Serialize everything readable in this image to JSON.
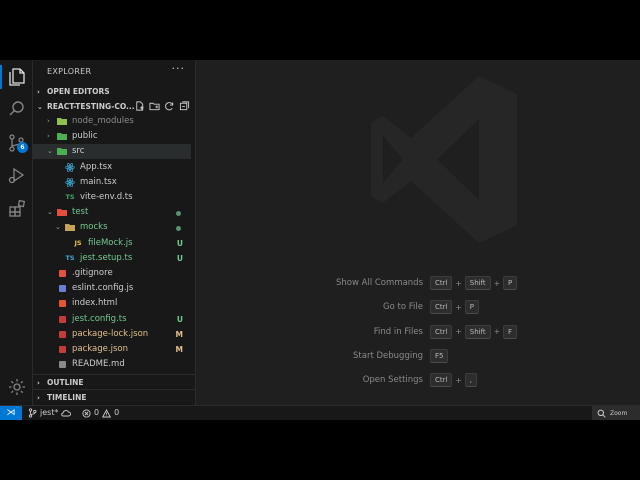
{
  "explorer": {
    "title": "EXPLORER",
    "more": "···"
  },
  "sections": {
    "open_editors": "OPEN EDITORS",
    "project": "REACT-TESTING-CO...",
    "outline": "OUTLINE",
    "timeline": "TIMELINE"
  },
  "activity": {
    "scm_badge": "6"
  },
  "tree": [
    {
      "label": "node_modules",
      "type": "folder",
      "open": false,
      "depth": 0,
      "muted": true,
      "icon_color": "#8bc34a"
    },
    {
      "label": "public",
      "type": "folder",
      "open": false,
      "depth": 0,
      "icon_color": "#4caf50"
    },
    {
      "label": "src",
      "type": "folder",
      "open": true,
      "depth": 0,
      "selected": true,
      "icon_color": "#4caf50"
    },
    {
      "label": "App.tsx",
      "type": "react",
      "depth": 1,
      "icon_color": "#3fa9d6"
    },
    {
      "label": "main.tsx",
      "type": "react",
      "depth": 1,
      "icon_color": "#3fa9d6"
    },
    {
      "label": "vite-env.d.ts",
      "type": "ts",
      "depth": 1,
      "icon_text": "TS",
      "icon_color": "#3ca86b"
    },
    {
      "label": "test",
      "type": "folder",
      "open": true,
      "depth": 0,
      "color": "#73c991",
      "dot": true,
      "icon_color": "#e74c3c"
    },
    {
      "label": "mocks",
      "type": "folder",
      "open": true,
      "depth": 1,
      "color": "#73c991",
      "dot": true,
      "icon_color": "#c8a15a"
    },
    {
      "label": "fileMock.js",
      "type": "js",
      "depth": 2,
      "icon_text": "JS",
      "icon_color": "#e0c44c",
      "color": "#73c991",
      "status": "U"
    },
    {
      "label": "jest.setup.ts",
      "type": "ts",
      "depth": 1,
      "icon_text": "TS",
      "icon_color": "#3fa9d6",
      "color": "#73c991",
      "status": "U"
    },
    {
      "label": ".gitignore",
      "type": "git",
      "depth": 0,
      "icon_color": "#e5533d"
    },
    {
      "label": "eslint.config.js",
      "type": "eslint",
      "depth": 0,
      "icon_color": "#6b7fd7"
    },
    {
      "label": "index.html",
      "type": "html",
      "depth": 0,
      "icon_color": "#e4572e"
    },
    {
      "label": "jest.config.ts",
      "type": "jest",
      "depth": 0,
      "icon_color": "#c43b3b",
      "color": "#73c991",
      "status": "U"
    },
    {
      "label": "package-lock.json",
      "type": "npm",
      "depth": 0,
      "icon_color": "#c43b3b",
      "color": "#e2c08d",
      "status": "M"
    },
    {
      "label": "package.json",
      "type": "npm",
      "depth": 0,
      "icon_color": "#c43b3b",
      "color": "#e2c08d",
      "status": "M"
    },
    {
      "label": "README.md",
      "type": "md",
      "depth": 0,
      "icon_color": "#8a8a8a"
    }
  ],
  "shortcuts": [
    {
      "label": "Show All Commands",
      "keys": [
        "Ctrl",
        "Shift",
        "P"
      ]
    },
    {
      "label": "Go to File",
      "keys": [
        "Ctrl",
        "P"
      ]
    },
    {
      "label": "Find in Files",
      "keys": [
        "Ctrl",
        "Shift",
        "F"
      ]
    },
    {
      "label": "Start Debugging",
      "keys": [
        "F5"
      ]
    },
    {
      "label": "Open Settings",
      "keys": [
        "Ctrl",
        ","
      ]
    }
  ],
  "statusbar": {
    "branch": "jest*",
    "errors": "0",
    "warnings": "0",
    "zoom_label": "Zoom"
  },
  "colors": {
    "accent": "#0078d4",
    "untracked": "#73c991",
    "modified": "#e2c08d"
  }
}
